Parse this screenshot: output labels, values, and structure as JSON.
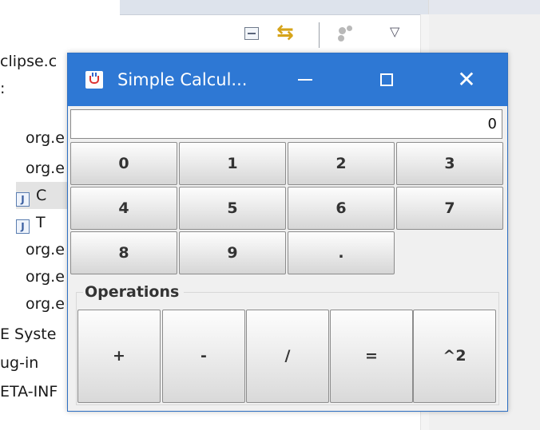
{
  "ide": {
    "tree_rows": [
      {
        "text": "clipse.c",
        "kind": "text"
      },
      {
        "text": ":",
        "kind": "text"
      },
      {
        "text": "org.e",
        "kind": "text"
      },
      {
        "text": "org.e",
        "kind": "text"
      },
      {
        "text": "C",
        "kind": "java-file",
        "icon": "J",
        "selected": true
      },
      {
        "text": "T",
        "kind": "java-file",
        "icon": "J"
      },
      {
        "text": "org.e",
        "kind": "text"
      },
      {
        "text": "org.e",
        "kind": "text"
      },
      {
        "text": "org.e",
        "kind": "text"
      },
      {
        "text": "E Syste",
        "kind": "text"
      },
      {
        "text": "ug-in",
        "kind": "text"
      },
      {
        "text": "ETA-INF",
        "kind": "text"
      }
    ],
    "toolbar_icons": [
      "collapse-all-icon",
      "link-with-editor-icon",
      "filter-icon",
      "view-menu-icon"
    ]
  },
  "window": {
    "title": "Simple Calcul...",
    "icon": "java-cup-icon",
    "title_bar_color": "#2e78d4",
    "controls": {
      "minimize": "—",
      "maximize": "☐",
      "close": "✕"
    }
  },
  "calculator": {
    "display_value": "0",
    "number_keys": [
      "0",
      "1",
      "2",
      "3",
      "4",
      "5",
      "6",
      "7",
      "8",
      "9",
      "."
    ],
    "operations_label": "Operations",
    "operation_keys": [
      "+",
      "-",
      "/",
      "=",
      "^2"
    ]
  }
}
